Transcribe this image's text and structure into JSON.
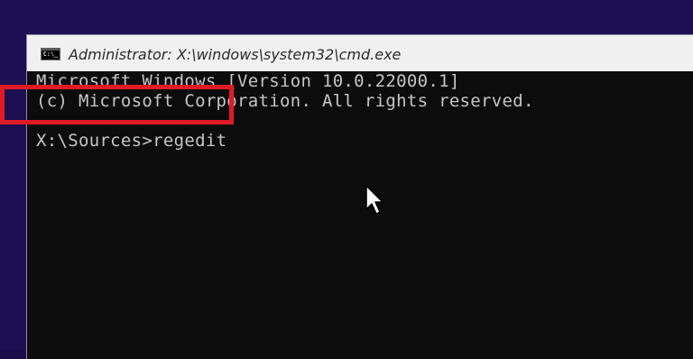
{
  "window": {
    "title": "Administrator: X:\\windows\\system32\\cmd.exe",
    "icon_label": "C:\\_"
  },
  "console": {
    "line1": "Microsoft Windows [Version 10.0.22000.1]",
    "line2": "(c) Microsoft Corporation. All rights reserved.",
    "prompt": "X:\\Sources>",
    "command": "regedit"
  },
  "colors": {
    "desktop_background": "#1d0f52",
    "console_background": "#0c0c0c",
    "console_text": "#c6c6c6",
    "titlebar": "#f0f0f0",
    "highlight": "#e01b24"
  },
  "icons": {
    "window_icon": "cmd-icon",
    "pointer": "mouse-pointer-icon"
  }
}
